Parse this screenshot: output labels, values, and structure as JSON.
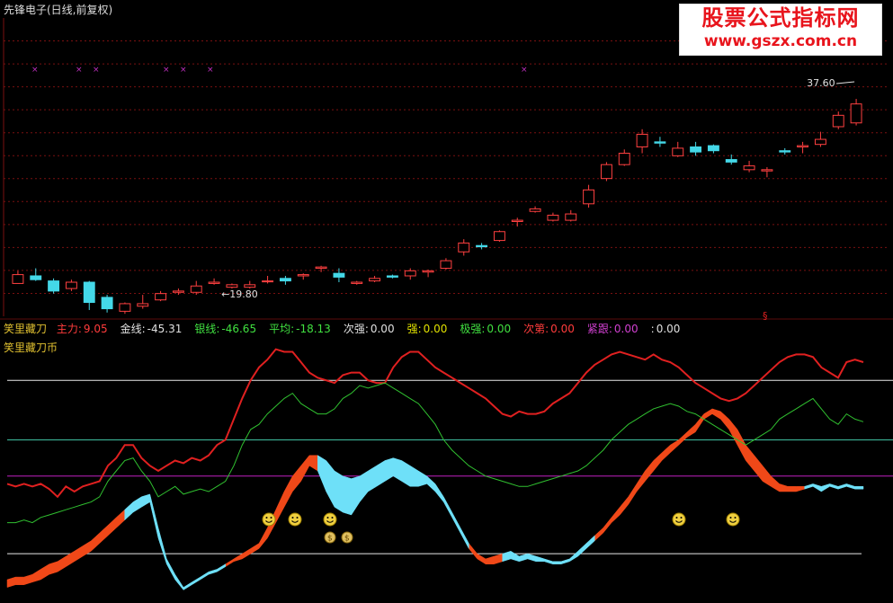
{
  "window": {
    "title": "先锋电子(日线,前复权)"
  },
  "watermark": {
    "line1": "股票公式指标网",
    "line2": "www.gszx.com.cn"
  },
  "indicator_bar": {
    "name": "笑里藏刀",
    "items": [
      {
        "label": "主力:",
        "value": "9.05",
        "color": "#ff3c3c"
      },
      {
        "label": "金线:",
        "value": "-45.31",
        "color": "#e0e0e0"
      },
      {
        "label": "银线:",
        "value": "-46.65",
        "color": "#40e040"
      },
      {
        "label": "平均:",
        "value": "-18.13",
        "color": "#40e040"
      },
      {
        "label": "次强:",
        "value": "0.00",
        "color": "#e0e0e0"
      },
      {
        "label": "强:",
        "value": "0.00",
        "color": "#e0e000"
      },
      {
        "label": "极强:",
        "value": "0.00",
        "color": "#40e040"
      },
      {
        "label": "次第:",
        "value": "0.00",
        "color": "#ff3c3c"
      },
      {
        "label": "紧跟:",
        "value": "0.00",
        "color": "#d040d0"
      },
      {
        "label": ":",
        "value": "0.00",
        "color": "#e0e0e0"
      }
    ]
  },
  "sub_title": "笑里藏刀币",
  "colors": {
    "up": "#ff4040",
    "down": "#44d8e8",
    "zhuli": "#e02020",
    "silver": "#30c030",
    "band_up": "#f04818",
    "band_down": "#6ee0f8",
    "grid": "#7a1010",
    "ref_line": "#e8e8e8",
    "mid_line": "#40c0a0",
    "purple": "#c020c0",
    "marker": "#c030c0"
  },
  "chart_data": [
    {
      "type": "candlestick",
      "title": "先锋电子(日线,前复权)",
      "annotations": [
        {
          "text": "37.60",
          "candle_index": 47,
          "kind": "high"
        },
        {
          "text": "19.80",
          "candle_index": 11,
          "kind": "low"
        }
      ],
      "candles": [
        [
          17.2,
          17.9,
          17.4,
          18.2
        ],
        [
          17.8,
          17.5,
          17.4,
          18.4
        ],
        [
          17.4,
          16.6,
          16.4,
          17.6
        ],
        [
          16.8,
          17.3,
          16.6,
          17.5
        ],
        [
          17.3,
          15.7,
          15.1,
          17.4
        ],
        [
          16.1,
          15.2,
          14.9,
          16.3
        ],
        [
          15.0,
          15.6,
          14.8,
          15.7
        ],
        [
          15.4,
          15.6,
          15.2,
          16.3
        ],
        [
          15.9,
          16.4,
          15.8,
          16.6
        ],
        [
          16.5,
          16.6,
          16.3,
          16.8
        ],
        [
          16.5,
          17.0,
          16.3,
          17.4
        ],
        [
          17.2,
          17.3,
          17.1,
          17.6
        ],
        [
          16.9,
          17.1,
          16.8,
          17.2
        ],
        [
          16.9,
          17.1,
          16.8,
          17.4
        ],
        [
          17.4,
          17.4,
          17.2,
          17.8
        ],
        [
          17.6,
          17.4,
          17.1,
          17.8
        ],
        [
          17.8,
          17.9,
          17.5,
          18.0
        ],
        [
          18.4,
          18.5,
          18.1,
          18.6
        ],
        [
          18.0,
          17.7,
          17.3,
          18.4
        ],
        [
          17.2,
          17.3,
          17.1,
          17.4
        ],
        [
          17.4,
          17.6,
          17.3,
          17.8
        ],
        [
          17.8,
          17.7,
          17.6,
          17.9
        ],
        [
          17.8,
          18.2,
          17.5,
          18.4
        ],
        [
          18.1,
          18.2,
          17.7,
          18.3
        ],
        [
          18.4,
          19.0,
          18.3,
          19.2
        ],
        [
          19.7,
          20.4,
          19.4,
          20.7
        ],
        [
          20.2,
          20.1,
          19.9,
          20.4
        ],
        [
          20.6,
          21.3,
          20.5,
          21.4
        ],
        [
          22.1,
          22.2,
          21.7,
          22.4
        ],
        [
          22.9,
          23.1,
          22.8,
          23.3
        ],
        [
          22.2,
          22.6,
          22.1,
          22.8
        ],
        [
          22.2,
          22.7,
          22.1,
          23.0
        ],
        [
          23.5,
          24.6,
          23.2,
          25.0
        ],
        [
          25.5,
          26.6,
          25.3,
          26.8
        ],
        [
          26.6,
          27.5,
          26.5,
          27.8
        ],
        [
          28.0,
          29.0,
          27.5,
          29.4
        ],
        [
          28.4,
          28.3,
          28.0,
          28.8
        ],
        [
          27.3,
          27.9,
          27.2,
          28.4
        ],
        [
          28.0,
          27.6,
          27.3,
          28.4
        ],
        [
          28.1,
          27.7,
          27.5,
          28.2
        ],
        [
          27.0,
          26.8,
          26.6,
          27.4
        ],
        [
          26.2,
          26.5,
          26.0,
          26.9
        ],
        [
          26.1,
          26.2,
          25.6,
          26.4
        ],
        [
          27.7,
          27.6,
          27.4,
          27.9
        ],
        [
          28.0,
          28.1,
          27.5,
          28.4
        ],
        [
          28.2,
          28.6,
          28.0,
          29.2
        ],
        [
          29.6,
          30.5,
          29.4,
          30.8
        ],
        [
          29.9,
          31.4,
          29.7,
          31.8
        ]
      ],
      "x_alignment_note": "",
      "ylim": [
        14.6,
        38.2
      ],
      "xlim": [
        0,
        100
      ]
    },
    {
      "type": "line",
      "title": "笑里藏刀币",
      "ylim": [
        0,
        100
      ],
      "x": [],
      "series": [
        {
          "name": "主力",
          "color": "#e02020",
          "values": [
            45,
            44,
            45,
            44,
            45,
            43,
            40,
            44,
            42,
            44,
            45,
            46,
            52,
            55,
            60,
            60,
            55,
            52,
            50,
            52,
            54,
            53,
            55,
            54,
            56,
            60,
            62,
            70,
            78,
            85,
            90,
            93,
            97,
            96,
            96,
            92,
            88,
            86,
            85,
            84,
            87,
            88,
            88,
            85,
            84,
            84,
            90,
            94,
            96,
            96,
            93,
            90,
            88,
            86,
            84,
            82,
            80,
            78,
            75,
            72,
            71,
            73,
            72,
            72,
            73,
            76,
            78,
            80,
            84,
            88,
            91,
            93,
            95,
            96,
            95,
            94,
            93,
            95,
            93,
            92,
            90,
            87,
            84,
            82,
            80,
            78,
            77,
            78,
            80,
            83,
            86,
            89,
            92,
            94,
            95,
            95,
            94,
            90,
            88,
            86,
            92,
            93,
            92
          ]
        },
        {
          "name": "银线",
          "color": "#30c030",
          "values": [
            30,
            30,
            31,
            30,
            32,
            33,
            34,
            35,
            36,
            37,
            38,
            40,
            46,
            50,
            54,
            55,
            50,
            46,
            40,
            42,
            44,
            41,
            42,
            43,
            42,
            44,
            46,
            52,
            60,
            66,
            68,
            72,
            75,
            78,
            80,
            76,
            74,
            72,
            72,
            74,
            78,
            80,
            83,
            82,
            83,
            84,
            82,
            80,
            78,
            76,
            72,
            68,
            62,
            58,
            55,
            52,
            50,
            48,
            47,
            46,
            45,
            44,
            44,
            45,
            46,
            47,
            48,
            49,
            50,
            52,
            55,
            58,
            62,
            65,
            68,
            70,
            72,
            74,
            75,
            76,
            75,
            73,
            72,
            70,
            68,
            66,
            64,
            62,
            60,
            62,
            64,
            66,
            70,
            72,
            74,
            76,
            78,
            74,
            70,
            68,
            72,
            70,
            69
          ]
        }
      ],
      "bands": [
        {
          "name": "上行",
          "color": "#f04818",
          "ranges": [
            [
              0,
              14
            ],
            [
              26,
              37
            ],
            [
              55,
              59
            ],
            [
              70,
              95
            ]
          ]
        },
        {
          "name": "下行",
          "color": "#6ee0f8",
          "ranges": [
            [
              14,
              26
            ],
            [
              37,
              55
            ],
            [
              59,
              70
            ],
            [
              95,
              102
            ]
          ]
        }
      ],
      "band_values": {
        "low": [
          5,
          6,
          6,
          7,
          8,
          10,
          11,
          13,
          15,
          17,
          19,
          22,
          25,
          28,
          31,
          34,
          36,
          38,
          24,
          14,
          8,
          4,
          6,
          8,
          10,
          11,
          13,
          15,
          16,
          18,
          20,
          24,
          30,
          36,
          42,
          46,
          52,
          50,
          42,
          36,
          34,
          33,
          38,
          42,
          44,
          46,
          48,
          46,
          44,
          44,
          45,
          42,
          38,
          32,
          26,
          20,
          16,
          14,
          14,
          15,
          16,
          15,
          16,
          15,
          15,
          14,
          14,
          15,
          17,
          20,
          23,
          26,
          30,
          33,
          37,
          42,
          46,
          50,
          54,
          57,
          60,
          63,
          65,
          70,
          72,
          70,
          66,
          60,
          54,
          50,
          46,
          44,
          42,
          42,
          42,
          43,
          44,
          42,
          44,
          43,
          44,
          43,
          43
        ],
        "high": [
          8,
          9,
          9,
          10,
          12,
          14,
          15,
          17,
          19,
          21,
          23,
          26,
          29,
          32,
          35,
          38,
          40,
          41,
          28,
          16,
          10,
          5,
          7,
          9,
          11,
          12,
          14,
          16,
          18,
          20,
          22,
          28,
          35,
          42,
          48,
          52,
          56,
          56,
          54,
          50,
          48,
          47,
          48,
          50,
          52,
          54,
          55,
          54,
          52,
          50,
          48,
          45,
          40,
          34,
          28,
          22,
          18,
          16,
          17,
          18,
          19,
          17,
          18,
          17,
          16,
          15,
          15,
          16,
          19,
          22,
          25,
          28,
          32,
          36,
          40,
          45,
          50,
          54,
          57,
          60,
          62,
          65,
          68,
          72,
          74,
          73,
          70,
          66,
          60,
          56,
          52,
          48,
          45,
          44,
          44,
          44,
          45,
          44,
          45,
          44,
          45,
          44,
          44
        ]
      },
      "ref_lines": [
        {
          "value": 85,
          "color": "#e8e8e8"
        },
        {
          "value": 62,
          "color": "#40c0a0"
        },
        {
          "value": 48,
          "color": "#c020c0"
        },
        {
          "value": 18,
          "color": "#e8e8e8"
        }
      ]
    }
  ]
}
